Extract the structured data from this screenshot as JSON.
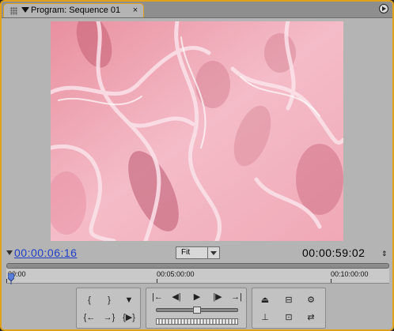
{
  "panel": {
    "tab_title": "Program: Sequence 01",
    "close_glyph": "×"
  },
  "timecode": {
    "current": "00:00:06:16",
    "duration": "00:00:59:02",
    "zoom_options": [
      "Fit"
    ],
    "zoom_selected": "Fit"
  },
  "ruler": {
    "labels": [
      "00:00",
      "00:05:00:00",
      "00:10:00:00"
    ]
  },
  "controls": {
    "left_group": [
      "mark-in",
      "mark-out",
      "set-marker",
      "go-to-in",
      "go-to-out",
      "play-in-to-out"
    ],
    "transport": [
      "go-to-previous-edit",
      "step-back",
      "play",
      "step-forward",
      "go-to-next-edit"
    ],
    "right_group": [
      "lift",
      "extract",
      "output",
      "trim",
      "safe-margins",
      "toggle"
    ]
  },
  "colors": {
    "frame_accent": "#e0a21c",
    "timecode_link": "#1e3ec8",
    "video_base": "#f3b6c2"
  }
}
